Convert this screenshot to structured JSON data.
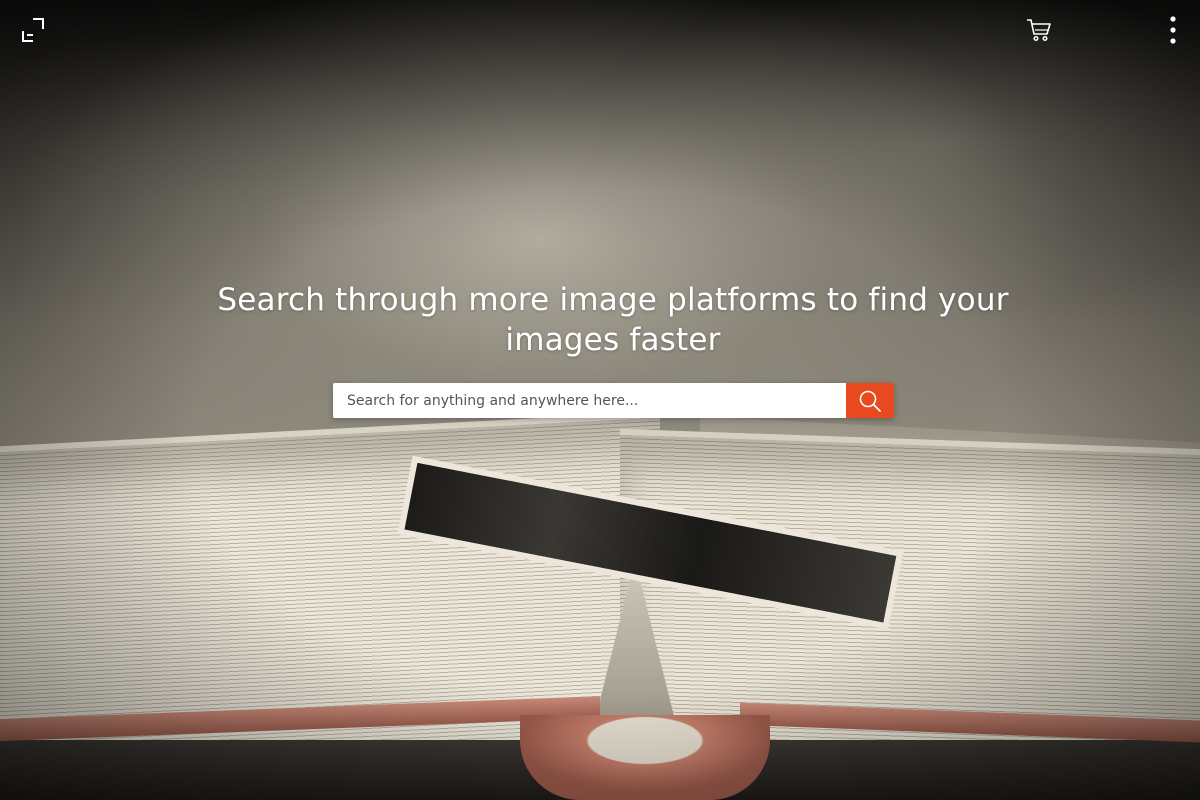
{
  "topbar": {
    "expand_icon": "expand-icon",
    "cart_icon": "cart-icon",
    "more_icon": "more-vertical-icon"
  },
  "hero": {
    "title": "Search through more image platforms  to find your images faster"
  },
  "search": {
    "placeholder": "Search for anything and anywhere here...",
    "value": "",
    "button_icon": "search-icon",
    "button_color": "#e8491f"
  },
  "colors": {
    "accent": "#e8491f",
    "text_on_image": "#ffffff"
  }
}
